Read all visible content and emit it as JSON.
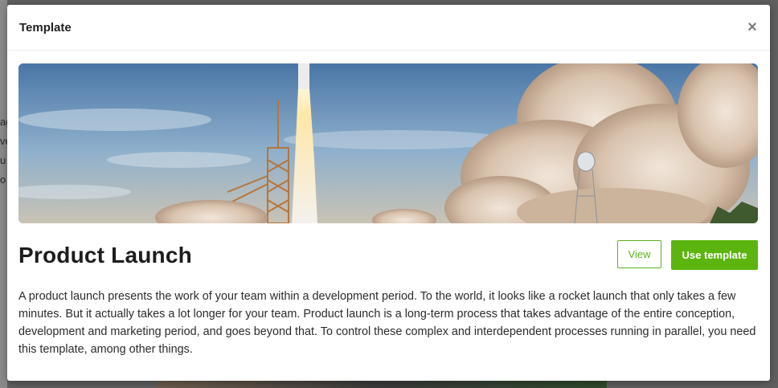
{
  "backdrop": {
    "partial_lines": [
      "ag",
      "ve",
      "u",
      "o"
    ]
  },
  "modal": {
    "title": "Template",
    "close_icon": "×"
  },
  "template": {
    "name": "Product Launch",
    "view_label": "View",
    "use_label": "Use template",
    "description": "A product launch presents the work of your team within a development period. To the world, it looks like a rocket launch that only takes a few minutes. But it actually takes a lot longer for your team. Product launch is a long-term process that takes advantage of the entire conception, development and marketing period, and goes beyond that. To control these complex and interdependent processes running in parallel, you need this template, among other things."
  },
  "colors": {
    "accent": "#5cb50e",
    "overlay": "#5f5f5f"
  },
  "hero_image": "rocket-launch-photo"
}
